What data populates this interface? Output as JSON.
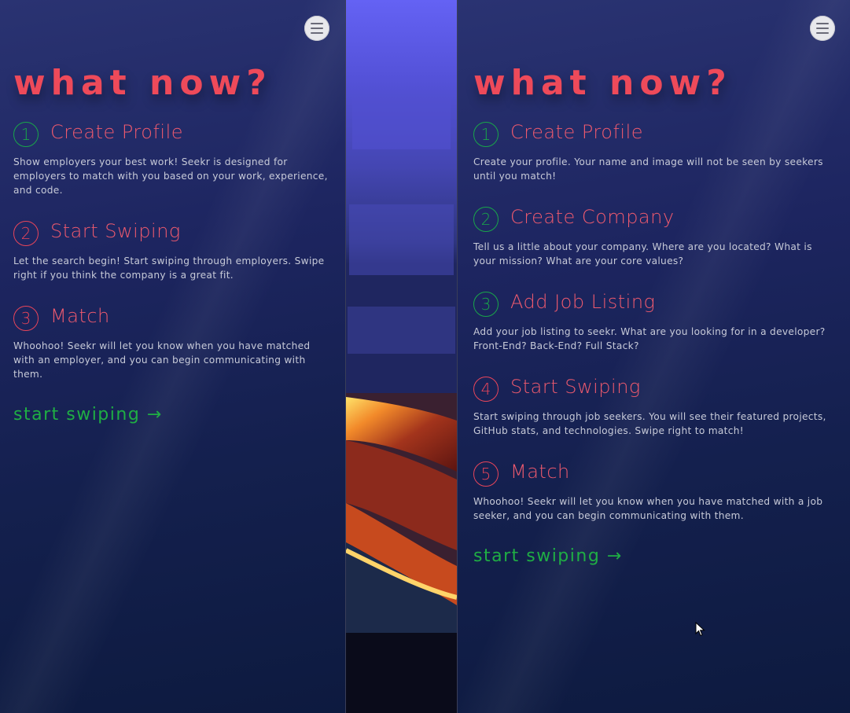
{
  "left_panel": {
    "heading": "what now?",
    "steps": [
      {
        "number": "1",
        "title": "Create Profile",
        "description": "Show employers your best work! Seekr is designed for employers to match with you based on your work, experience, and code.",
        "color": "green"
      },
      {
        "number": "2",
        "title": "Start Swiping",
        "description": "Let the search begin! Start swiping through employers. Swipe right if you think the company is a great fit.",
        "color": "red"
      },
      {
        "number": "3",
        "title": "Match",
        "description": "Whoohoo! Seekr will let you know when you have matched with an employer, and you can begin communicating with them.",
        "color": "red"
      }
    ],
    "cta": "start swiping →"
  },
  "right_panel": {
    "heading": "what now?",
    "steps": [
      {
        "number": "1",
        "title": "Create Profile",
        "description": "Create your profile. Your name and image will not be seen by seekers until you match!",
        "color": "green"
      },
      {
        "number": "2",
        "title": "Create Company",
        "description": "Tell us a little about your company. Where are you located? What is your mission? What are your core values?",
        "color": "green"
      },
      {
        "number": "3",
        "title": "Add Job Listing",
        "description": "Add your job listing to seekr. What are you looking for in a developer? Front-End? Back-End? Full Stack?",
        "color": "green"
      },
      {
        "number": "4",
        "title": "Start Swiping",
        "description": "Start swiping through job seekers. You will see their featured projects, GitHub stats, and technologies. Swipe right to match!",
        "color": "red"
      },
      {
        "number": "5",
        "title": "Match",
        "description": "Whoohoo! Seekr will let you know when you have matched with a job seeker, and you can begin communicating with them.",
        "color": "red"
      }
    ],
    "cta": "start swiping →"
  },
  "icons": {
    "menu": "hamburger-menu-icon",
    "cursor": "mouse-pointer-icon"
  },
  "colors": {
    "heading": "#ee4a5a",
    "step_title": "#ee5a6e",
    "cta": "#1fae44",
    "step_green": "#19a64a",
    "step_red": "#e8455a"
  }
}
